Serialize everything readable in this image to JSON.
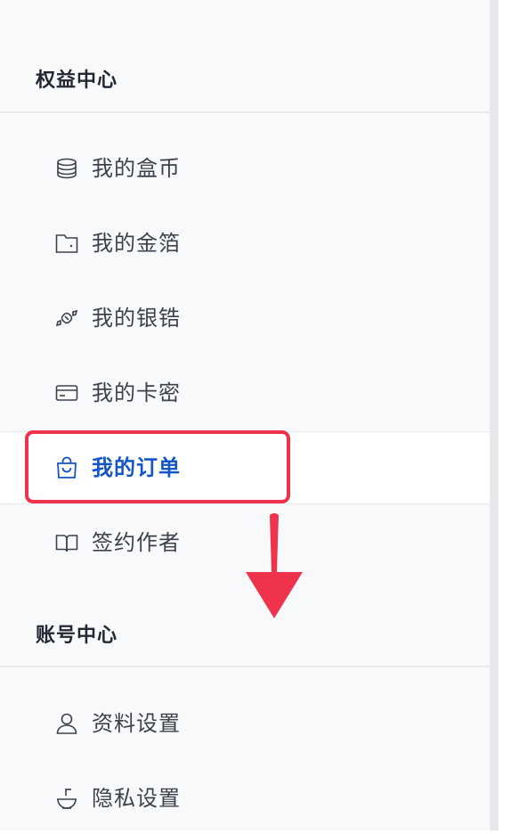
{
  "sections": [
    {
      "title": "权益中心",
      "items": [
        {
          "label": "我的盒币",
          "icon": "coins-stack-icon",
          "active": false
        },
        {
          "label": "我的金箔",
          "icon": "wallet-icon",
          "active": false
        },
        {
          "label": "我的银锆",
          "icon": "candy-icon",
          "active": false
        },
        {
          "label": "我的卡密",
          "icon": "card-icon",
          "active": false
        },
        {
          "label": "我的订单",
          "icon": "shopping-bag-icon",
          "active": true
        },
        {
          "label": "签约作者",
          "icon": "open-book-icon",
          "active": false
        }
      ]
    },
    {
      "title": "账号中心",
      "items": [
        {
          "label": "资料设置",
          "icon": "user-icon",
          "active": false
        },
        {
          "label": "隐私设置",
          "icon": "privacy-bowl-icon",
          "active": false
        }
      ]
    }
  ],
  "colors": {
    "sidebar_bg": "#f8f9fb",
    "active_text": "#1556c4",
    "text": "#3c424c",
    "annotation": "#f0334d"
  }
}
